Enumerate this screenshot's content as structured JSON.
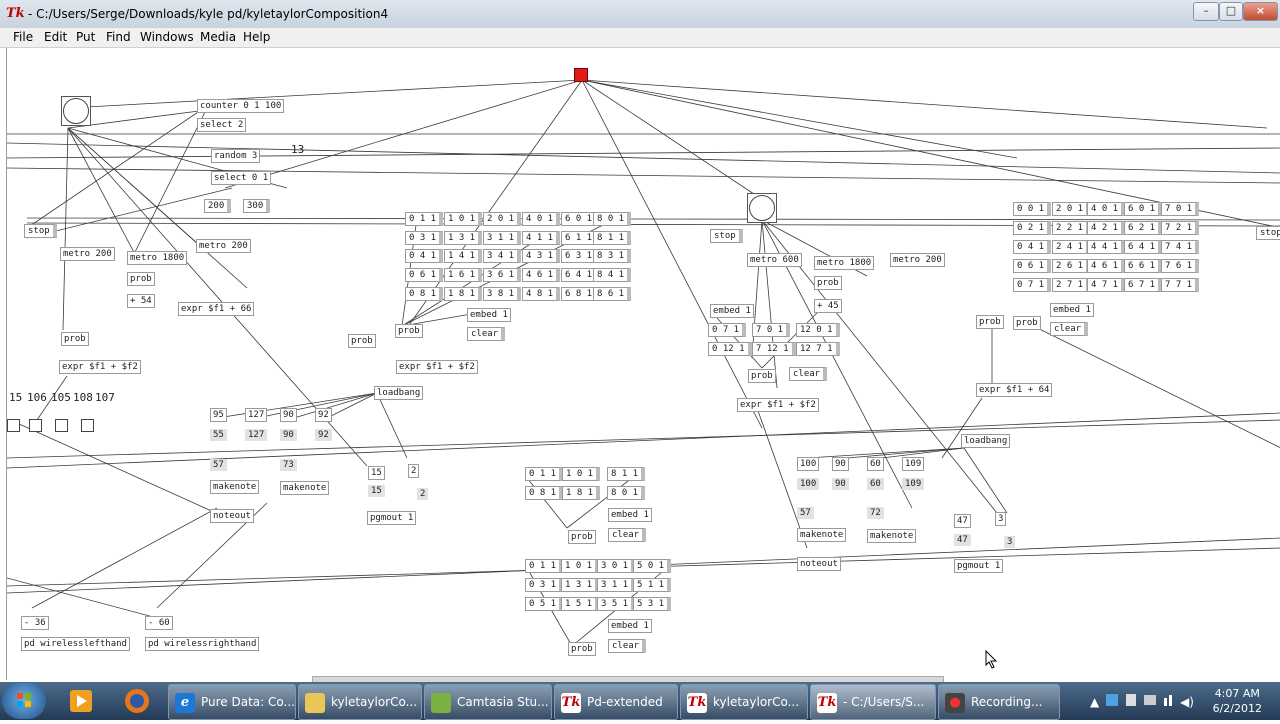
{
  "window": {
    "title": "- C:/Users/Serge/Downloads/kyle pd/kyletaylorComposition4",
    "app_icon": "Tk",
    "min": "–",
    "max": "□",
    "close": "×"
  },
  "menubar": [
    "File",
    "Edit",
    "Put",
    "Find",
    "Windows",
    "Media",
    "Help"
  ],
  "canvas": {
    "labels": {
      "thirteen": "13"
    },
    "objects": {
      "counter": "counter 0 1 100",
      "select2": "select 2",
      "random": "random 3",
      "select01": "select 0 1",
      "n200": "200",
      "n300": "300",
      "stop1": "stop",
      "metro200a": "metro 200",
      "metro1800a": "metro 1800",
      "metro200b": "metro 200",
      "prob1": "prob",
      "plus54": "+ 54",
      "expr66": "expr $f1 + 66",
      "prob2": "prob",
      "exprL": "expr $f1 + $f2",
      "prob3": "prob",
      "loadbang1": "loadbang",
      "expr2": "expr $f1 + $f2",
      "probM": "prob",
      "stop2": "stop",
      "metro600": "metro 600",
      "metro1800b": "metro 1800",
      "metro200c": "metro 200",
      "prob4": "prob",
      "plus45": "+ 45",
      "probR": "prob",
      "exprR": "expr $f1 + 64",
      "loadbang2": "loadbang",
      "probE": "prob",
      "exprE": "expr $f1 + $f2",
      "stopR": "stop",
      "makenote1": "makenote",
      "makenote2": "makenote",
      "noteout1": "noteout",
      "pgmout1": "pgmout 1",
      "makenote3": "makenote",
      "makenote4": "makenote",
      "noteout2": "noteout",
      "pgmout2": "pgmout 1",
      "probC1": "prob",
      "probC2": "prob",
      "minus36": "- 36",
      "minus60": "- 60",
      "wlh": "pd wirelesslefthand",
      "wrh": "pd wirelessrighthand"
    },
    "embed": "embed 1",
    "clear": "clear",
    "toggle_numbers": [
      "15",
      "106",
      "105",
      "108",
      "107"
    ],
    "notes_left": {
      "top": [
        "95",
        "127",
        "90",
        "92"
      ],
      "mid": [
        "55",
        "127",
        "90",
        "92"
      ],
      "n57": "57",
      "n73": "73",
      "n15a": "15",
      "n15b": "15",
      "n2a": "2",
      "n2b": "2"
    },
    "notes_right": {
      "top": [
        "100",
        "90",
        "60",
        "109"
      ],
      "mid": [
        "100",
        "90",
        "60",
        "109"
      ],
      "n57": "57",
      "n72": "72",
      "n47a": "47",
      "n47b": "47",
      "n3a": "3",
      "n3b": "3"
    },
    "msg_mid": [
      [
        "0 1 1",
        "1 0 1",
        "2 0 1",
        "4 0 1",
        "6 0 1",
        "8 0 1"
      ],
      [
        "0 3 1",
        "1 3 1",
        "3 1 1",
        "4 1 1",
        "6 1 1",
        "8 1 1"
      ],
      [
        "0 4 1",
        "1 4 1",
        "3 4 1",
        "4 3 1",
        "6 3 1",
        "8 3 1"
      ],
      [
        "0 6 1",
        "1 6 1",
        "3 6 1",
        "4 6 1",
        "6 4 1",
        "8 4 1"
      ],
      [
        "0 8 1",
        "1 8 1",
        "3 8 1",
        "4 8 1",
        "6 8 1",
        "8 6 1"
      ]
    ],
    "msg_right": [
      [
        "0 0 1",
        "2 0 1",
        "4 0 1",
        "6 0 1",
        "7 0 1"
      ],
      [
        "0 2 1",
        "2 2 1",
        "4 2 1",
        "6 2 1",
        "7 2 1"
      ],
      [
        "0 4 1",
        "2 4 1",
        "4 4 1",
        "6 4 1",
        "7 4 1"
      ],
      [
        "0 6 1",
        "2 6 1",
        "4 6 1",
        "6 6 1",
        "7 6 1"
      ],
      [
        "0 7 1",
        "2 7 1",
        "4 7 1",
        "6 7 1",
        "7 7 1"
      ]
    ],
    "msg_small": [
      [
        "0 7 1",
        "7 0 1",
        "12 0 1"
      ],
      [
        "0 12 1",
        "7 12 1",
        "12 7 1"
      ]
    ],
    "msg_c1": [
      [
        "0 1 1",
        "1 0 1",
        "8 1 1"
      ],
      [
        "0 8 1",
        "1 8 1",
        "8 0 1"
      ]
    ],
    "msg_c2": [
      [
        "0 1 1",
        "1 0 1",
        "3 0 1",
        "5 0 1"
      ],
      [
        "0 3 1",
        "1 3 1",
        "3 1 1",
        "5 1 1"
      ],
      [
        "0 5 1",
        "1 5 1",
        "3 5 1",
        "5 3 1"
      ]
    ]
  },
  "taskbar": {
    "buttons": [
      {
        "label": "Pure Data: Co...",
        "icon": "ie-icon"
      },
      {
        "label": "kyletaylorCo...",
        "icon": "folder-icon"
      },
      {
        "label": "Camtasia Stu...",
        "icon": "camtasia-icon"
      },
      {
        "label": "Pd-extended",
        "icon": "tk-icon"
      },
      {
        "label": "kyletaylorCo...",
        "icon": "tk-icon"
      },
      {
        "label": "- C:/Users/S...",
        "icon": "tk-icon"
      },
      {
        "label": "Recording...",
        "icon": "recorder-icon"
      }
    ],
    "time": "4:07 AM",
    "date": "6/2/2012"
  }
}
